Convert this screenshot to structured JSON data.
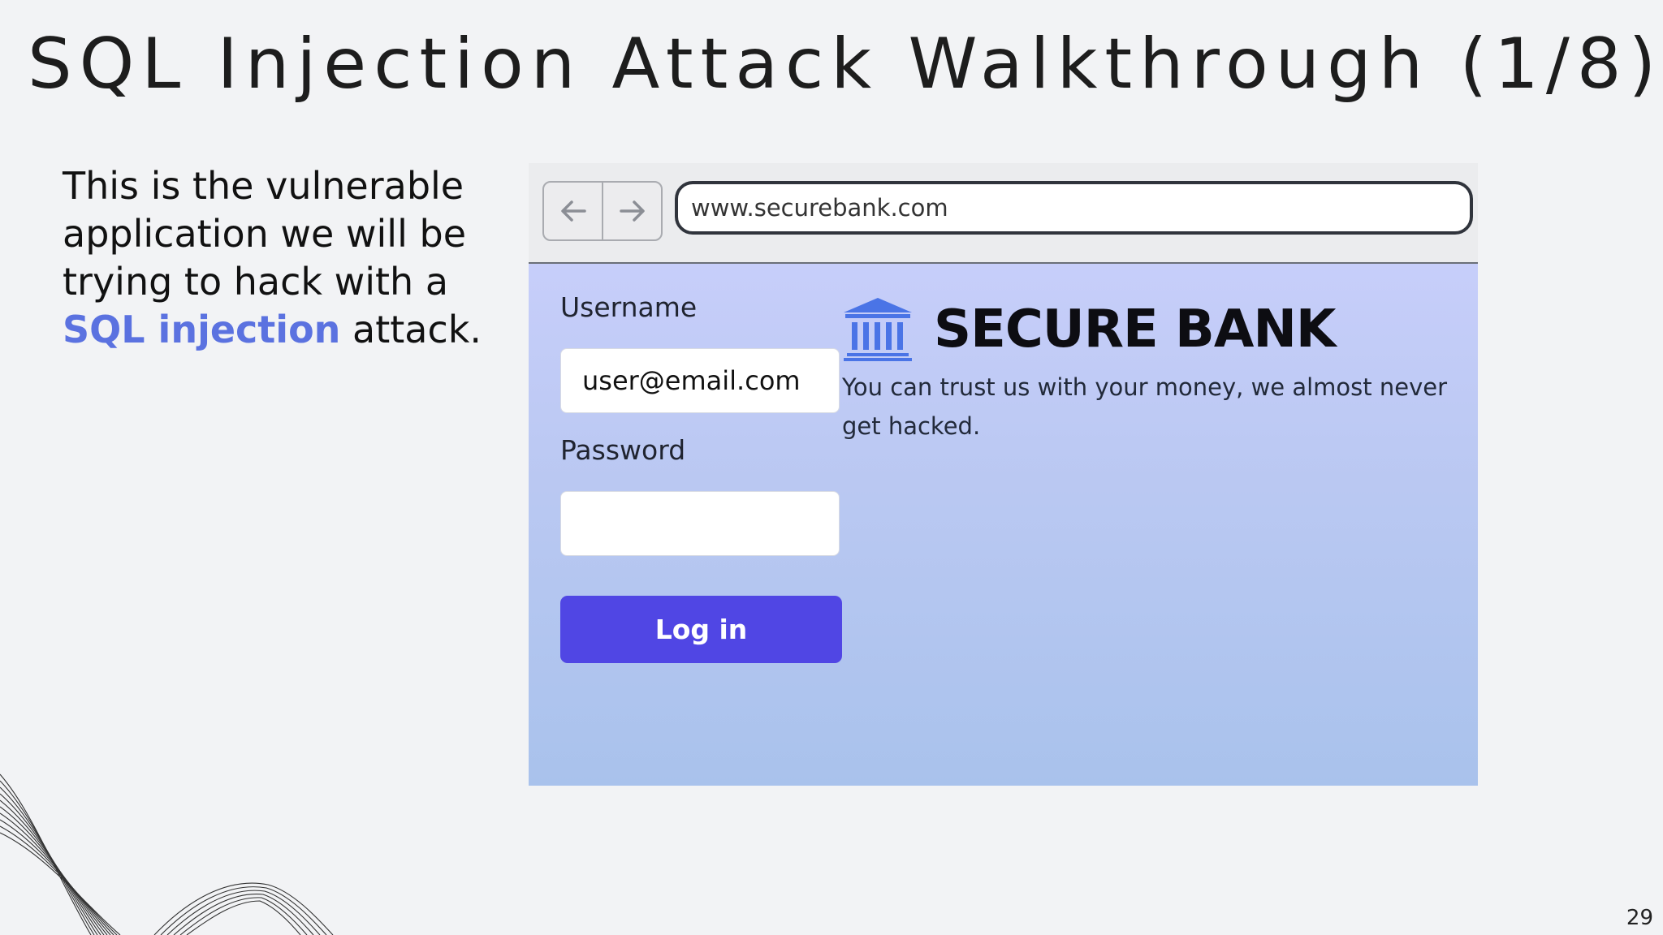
{
  "slide": {
    "title": "SQL Injection Attack Walkthrough (1/8)",
    "intro_before": "This is the vulnerable application we will be trying to hack with a ",
    "intro_highlight": "SQL injection",
    "intro_after": " attack.",
    "page_number": "29"
  },
  "browser": {
    "back_icon": "arrow-left-icon",
    "forward_icon": "arrow-right-icon",
    "url": "www.securebank.com"
  },
  "login_form": {
    "username_label": "Username",
    "username_value": "user@email.com",
    "password_label": "Password",
    "password_value": "",
    "login_button": "Log in"
  },
  "bank": {
    "logo_icon": "bank-building-icon",
    "name": "SECURE BANK",
    "tagline": "You can trust us with your money, we almost never get hacked."
  },
  "colors": {
    "highlight": "#5b72e0",
    "login_button": "#5046e4",
    "logo": "#4a74e6"
  }
}
